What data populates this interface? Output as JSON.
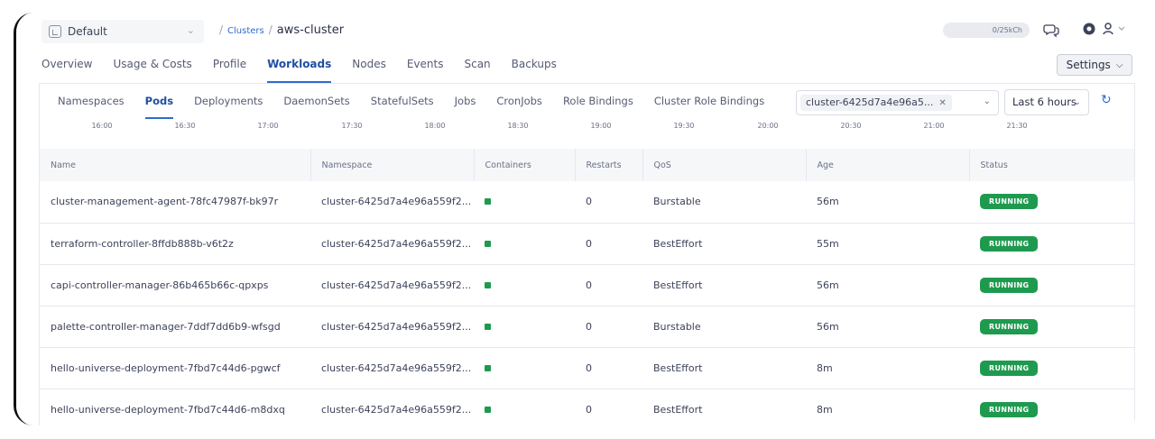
{
  "header": {
    "project": "Default",
    "breadcrumb": {
      "parent": "Clusters",
      "current": "aws-cluster"
    },
    "usage": "0/25kCh"
  },
  "main_tabs": [
    {
      "label": "Overview"
    },
    {
      "label": "Usage & Costs"
    },
    {
      "label": "Profile"
    },
    {
      "label": "Workloads",
      "active": true
    },
    {
      "label": "Nodes"
    },
    {
      "label": "Events"
    },
    {
      "label": "Scan"
    },
    {
      "label": "Backups"
    }
  ],
  "settings": {
    "label": "Settings"
  },
  "sub_tabs": [
    {
      "label": "Namespaces"
    },
    {
      "label": "Pods",
      "active": true
    },
    {
      "label": "Deployments"
    },
    {
      "label": "DaemonSets"
    },
    {
      "label": "StatefulSets"
    },
    {
      "label": "Jobs"
    },
    {
      "label": "CronJobs"
    },
    {
      "label": "Role Bindings"
    },
    {
      "label": "Cluster Role Bindings"
    }
  ],
  "namespace_filter": {
    "chip": "cluster-6425d7a4e96a5..."
  },
  "time_range": {
    "label": "Last 6 hours"
  },
  "timeline": [
    "16:00",
    "16:30",
    "17:00",
    "17:30",
    "18:00",
    "18:30",
    "19:00",
    "19:30",
    "20:00",
    "20:30",
    "21:00",
    "21:30"
  ],
  "table": {
    "columns": [
      "Name",
      "Namespace",
      "Containers",
      "Restarts",
      "QoS",
      "Age",
      "Status"
    ],
    "rows": [
      {
        "name": "cluster-management-agent-78fc47987f-bk97r",
        "namespace": "cluster-6425d7a4e96a559f2...",
        "restarts": "0",
        "qos": "Burstable",
        "age": "56m",
        "status": "RUNNING"
      },
      {
        "name": "terraform-controller-8ffdb888b-v6t2z",
        "namespace": "cluster-6425d7a4e96a559f2...",
        "restarts": "0",
        "qos": "BestEffort",
        "age": "55m",
        "status": "RUNNING"
      },
      {
        "name": "capi-controller-manager-86b465b66c-qpxps",
        "namespace": "cluster-6425d7a4e96a559f2...",
        "restarts": "0",
        "qos": "BestEffort",
        "age": "56m",
        "status": "RUNNING"
      },
      {
        "name": "palette-controller-manager-7ddf7dd6b9-wfsgd",
        "namespace": "cluster-6425d7a4e96a559f2...",
        "restarts": "0",
        "qos": "Burstable",
        "age": "56m",
        "status": "RUNNING"
      },
      {
        "name": "hello-universe-deployment-7fbd7c44d6-pgwcf",
        "namespace": "cluster-6425d7a4e96a559f2...",
        "restarts": "0",
        "qos": "BestEffort",
        "age": "8m",
        "status": "RUNNING"
      },
      {
        "name": "hello-universe-deployment-7fbd7c44d6-m8dxq",
        "namespace": "cluster-6425d7a4e96a559f2...",
        "restarts": "0",
        "qos": "BestEffort",
        "age": "8m",
        "status": "RUNNING"
      }
    ]
  },
  "colors": {
    "accent": "#2e6bd2",
    "running": "#1e9a4f"
  }
}
